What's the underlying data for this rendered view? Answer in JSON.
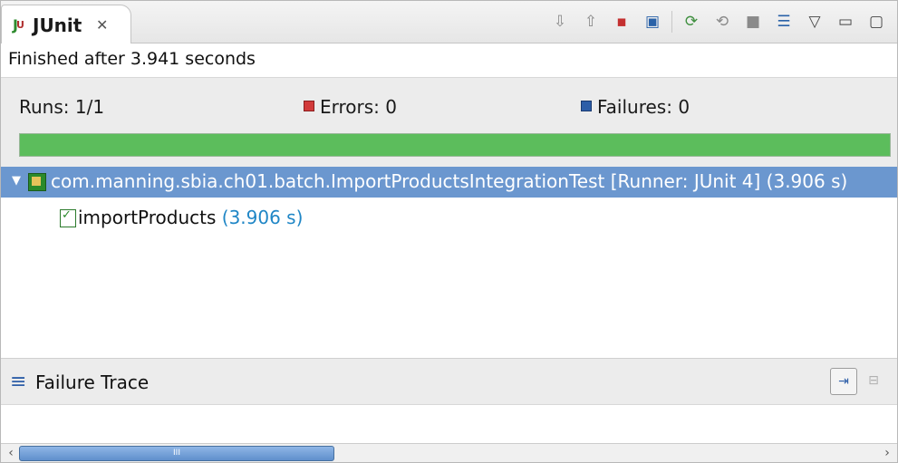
{
  "tab": {
    "title": "JUnit",
    "close_glyph": "✕"
  },
  "toolbar": {
    "icons": [
      "next-failure-icon",
      "previous-failure-icon",
      "show-failures-only-icon",
      "scroll-lock-icon",
      "rerun-test-icon",
      "rerun-failed-first-icon",
      "stop-icon",
      "test-history-icon",
      "view-menu-icon",
      "minimize-icon",
      "maximize-icon"
    ]
  },
  "status": {
    "text": "Finished after 3.941 seconds"
  },
  "counters": {
    "runs_label": "Runs:",
    "runs_value": "1/1",
    "errors_label": "Errors:",
    "errors_value": "0",
    "failures_label": "Failures:",
    "failures_value": "0",
    "error_color": "#d23a3a",
    "failure_color": "#2d5ea8"
  },
  "progress": {
    "fraction": 1.0,
    "color": "#5cbd5c"
  },
  "tree": {
    "suite_label": "com.manning.sbia.ch01.batch.ImportProductsIntegrationTest [Runner: JUnit 4] (3.906 s)",
    "test_name": "importProducts",
    "test_time": "(3.906 s)",
    "selected_color": "#6b97cf"
  },
  "trace": {
    "title": "Failure Trace"
  },
  "scrollbar": {
    "thumb_grip": "III"
  }
}
